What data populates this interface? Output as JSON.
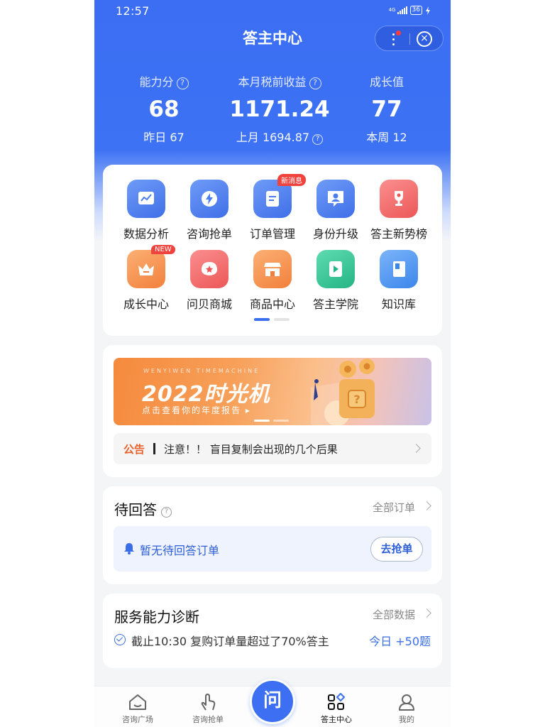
{
  "status_bar": {
    "time": "12:57",
    "network": "4G",
    "battery": "36"
  },
  "header": {
    "title": "答主中心"
  },
  "stats": [
    {
      "label": "能力分",
      "value": "68",
      "sub": "昨日 67"
    },
    {
      "label": "本月税前收益",
      "value": "1171.24",
      "sub": "上月 1694.87"
    },
    {
      "label": "成长值",
      "value": "77",
      "sub": "本周 12"
    }
  ],
  "grid": {
    "items": [
      {
        "label": "数据分析",
        "icon": "chart-icon",
        "color": "#4a7df0"
      },
      {
        "label": "咨询抢单",
        "icon": "lightning-icon",
        "color": "#4a7df0"
      },
      {
        "label": "订单管理",
        "icon": "document-icon",
        "color": "#4a7df0",
        "badge": "新消息"
      },
      {
        "label": "身份升级",
        "icon": "user-chat-icon",
        "color": "#4a7df0"
      },
      {
        "label": "答主新势榜",
        "icon": "trophy-icon",
        "color": "#f26868"
      },
      {
        "label": "成长中心",
        "icon": "crown-icon",
        "color": "#f7924a",
        "badge": "NEW"
      },
      {
        "label": "问贝商城",
        "icon": "shell-icon",
        "color": "#f26868"
      },
      {
        "label": "商品中心",
        "icon": "store-icon",
        "color": "#f7924a"
      },
      {
        "label": "答主学院",
        "icon": "play-icon",
        "color": "#35c79a"
      },
      {
        "label": "知识库",
        "icon": "book-icon",
        "color": "#4a93f0"
      }
    ]
  },
  "banner": {
    "eng": "WENYIWEN TIMEMACHINE",
    "title": "2022时光机",
    "sub": "点击查看你的年度报告 ▸"
  },
  "notice": {
    "tag": "公告",
    "text": "注意！！ 盲目复制会出现的几个后果"
  },
  "pending": {
    "title": "待回答",
    "link": "全部订单",
    "empty_text": "暂无待回答订单",
    "button": "去抢单"
  },
  "service": {
    "title": "服务能力诊断",
    "link": "全部数据",
    "text": "截止10:30 复购订单量超过了70%答主",
    "today": "今日 +50题"
  },
  "tabs": [
    {
      "label": "咨询广场",
      "icon": "home-icon"
    },
    {
      "label": "咨询抢单",
      "icon": "hand-tap-icon"
    },
    {
      "label": "问",
      "icon": "ask-button"
    },
    {
      "label": "答主中心",
      "icon": "grid-diamond-icon",
      "active": true
    },
    {
      "label": "我的",
      "icon": "person-icon"
    }
  ],
  "colors": {
    "primary": "#3d6ff2",
    "accent_orange": "#e8622b",
    "badge_red": "#f0433e"
  }
}
